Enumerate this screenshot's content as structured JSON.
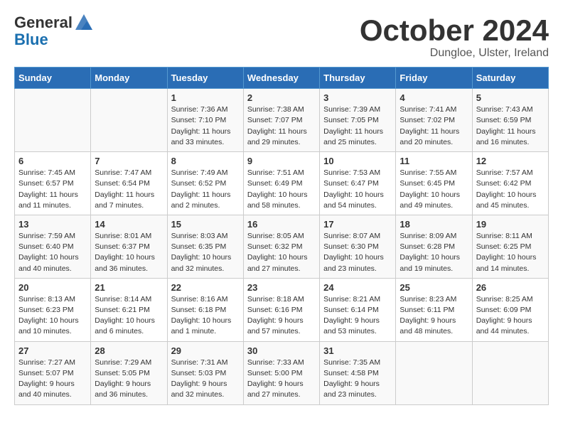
{
  "header": {
    "logo_general": "General",
    "logo_blue": "Blue",
    "month": "October 2024",
    "location": "Dungloe, Ulster, Ireland"
  },
  "days_of_week": [
    "Sunday",
    "Monday",
    "Tuesday",
    "Wednesday",
    "Thursday",
    "Friday",
    "Saturday"
  ],
  "weeks": [
    [
      {
        "day": "",
        "info": ""
      },
      {
        "day": "",
        "info": ""
      },
      {
        "day": "1",
        "info": "Sunrise: 7:36 AM\nSunset: 7:10 PM\nDaylight: 11 hours\nand 33 minutes."
      },
      {
        "day": "2",
        "info": "Sunrise: 7:38 AM\nSunset: 7:07 PM\nDaylight: 11 hours\nand 29 minutes."
      },
      {
        "day": "3",
        "info": "Sunrise: 7:39 AM\nSunset: 7:05 PM\nDaylight: 11 hours\nand 25 minutes."
      },
      {
        "day": "4",
        "info": "Sunrise: 7:41 AM\nSunset: 7:02 PM\nDaylight: 11 hours\nand 20 minutes."
      },
      {
        "day": "5",
        "info": "Sunrise: 7:43 AM\nSunset: 6:59 PM\nDaylight: 11 hours\nand 16 minutes."
      }
    ],
    [
      {
        "day": "6",
        "info": "Sunrise: 7:45 AM\nSunset: 6:57 PM\nDaylight: 11 hours\nand 11 minutes."
      },
      {
        "day": "7",
        "info": "Sunrise: 7:47 AM\nSunset: 6:54 PM\nDaylight: 11 hours\nand 7 minutes."
      },
      {
        "day": "8",
        "info": "Sunrise: 7:49 AM\nSunset: 6:52 PM\nDaylight: 11 hours\nand 2 minutes."
      },
      {
        "day": "9",
        "info": "Sunrise: 7:51 AM\nSunset: 6:49 PM\nDaylight: 10 hours\nand 58 minutes."
      },
      {
        "day": "10",
        "info": "Sunrise: 7:53 AM\nSunset: 6:47 PM\nDaylight: 10 hours\nand 54 minutes."
      },
      {
        "day": "11",
        "info": "Sunrise: 7:55 AM\nSunset: 6:45 PM\nDaylight: 10 hours\nand 49 minutes."
      },
      {
        "day": "12",
        "info": "Sunrise: 7:57 AM\nSunset: 6:42 PM\nDaylight: 10 hours\nand 45 minutes."
      }
    ],
    [
      {
        "day": "13",
        "info": "Sunrise: 7:59 AM\nSunset: 6:40 PM\nDaylight: 10 hours\nand 40 minutes."
      },
      {
        "day": "14",
        "info": "Sunrise: 8:01 AM\nSunset: 6:37 PM\nDaylight: 10 hours\nand 36 minutes."
      },
      {
        "day": "15",
        "info": "Sunrise: 8:03 AM\nSunset: 6:35 PM\nDaylight: 10 hours\nand 32 minutes."
      },
      {
        "day": "16",
        "info": "Sunrise: 8:05 AM\nSunset: 6:32 PM\nDaylight: 10 hours\nand 27 minutes."
      },
      {
        "day": "17",
        "info": "Sunrise: 8:07 AM\nSunset: 6:30 PM\nDaylight: 10 hours\nand 23 minutes."
      },
      {
        "day": "18",
        "info": "Sunrise: 8:09 AM\nSunset: 6:28 PM\nDaylight: 10 hours\nand 19 minutes."
      },
      {
        "day": "19",
        "info": "Sunrise: 8:11 AM\nSunset: 6:25 PM\nDaylight: 10 hours\nand 14 minutes."
      }
    ],
    [
      {
        "day": "20",
        "info": "Sunrise: 8:13 AM\nSunset: 6:23 PM\nDaylight: 10 hours\nand 10 minutes."
      },
      {
        "day": "21",
        "info": "Sunrise: 8:14 AM\nSunset: 6:21 PM\nDaylight: 10 hours\nand 6 minutes."
      },
      {
        "day": "22",
        "info": "Sunrise: 8:16 AM\nSunset: 6:18 PM\nDaylight: 10 hours\nand 1 minute."
      },
      {
        "day": "23",
        "info": "Sunrise: 8:18 AM\nSunset: 6:16 PM\nDaylight: 9 hours\nand 57 minutes."
      },
      {
        "day": "24",
        "info": "Sunrise: 8:21 AM\nSunset: 6:14 PM\nDaylight: 9 hours\nand 53 minutes."
      },
      {
        "day": "25",
        "info": "Sunrise: 8:23 AM\nSunset: 6:11 PM\nDaylight: 9 hours\nand 48 minutes."
      },
      {
        "day": "26",
        "info": "Sunrise: 8:25 AM\nSunset: 6:09 PM\nDaylight: 9 hours\nand 44 minutes."
      }
    ],
    [
      {
        "day": "27",
        "info": "Sunrise: 7:27 AM\nSunset: 5:07 PM\nDaylight: 9 hours\nand 40 minutes."
      },
      {
        "day": "28",
        "info": "Sunrise: 7:29 AM\nSunset: 5:05 PM\nDaylight: 9 hours\nand 36 minutes."
      },
      {
        "day": "29",
        "info": "Sunrise: 7:31 AM\nSunset: 5:03 PM\nDaylight: 9 hours\nand 32 minutes."
      },
      {
        "day": "30",
        "info": "Sunrise: 7:33 AM\nSunset: 5:00 PM\nDaylight: 9 hours\nand 27 minutes."
      },
      {
        "day": "31",
        "info": "Sunrise: 7:35 AM\nSunset: 4:58 PM\nDaylight: 9 hours\nand 23 minutes."
      },
      {
        "day": "",
        "info": ""
      },
      {
        "day": "",
        "info": ""
      }
    ]
  ]
}
